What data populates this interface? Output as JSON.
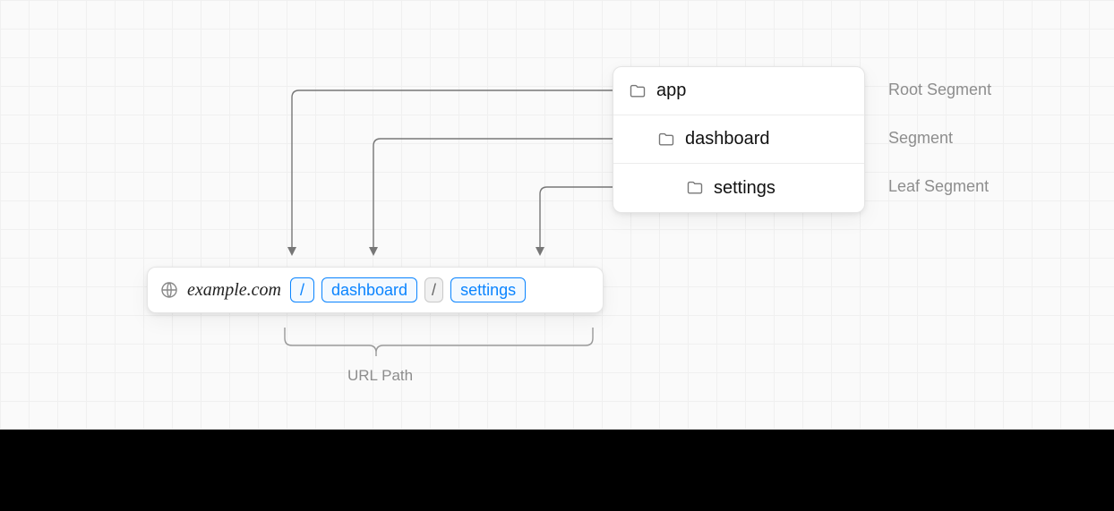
{
  "tree": {
    "items": [
      {
        "name": "app",
        "label": "Root Segment"
      },
      {
        "name": "dashboard",
        "label": "Segment"
      },
      {
        "name": "settings",
        "label": "Leaf Segment"
      }
    ]
  },
  "url": {
    "domain": "example.com",
    "sep1": "/",
    "seg1": "dashboard",
    "sep2": "/",
    "seg2": "settings"
  },
  "url_path_label": "URL Path"
}
